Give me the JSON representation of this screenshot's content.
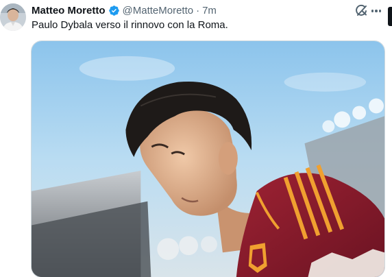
{
  "tweet": {
    "author": {
      "display_name": "Matteo Moretto",
      "handle": "@MatteMoretto",
      "verified": true
    },
    "separator": "·",
    "time": "7m",
    "text": "Paulo Dybala verso il rinnovo con la Roma.",
    "media": {
      "type": "photo",
      "subject": "footballer",
      "colors": {
        "sky": "#8cc4ec",
        "jersey": "#8a1c2c",
        "stripes": "#f0a030",
        "hair": "#1e1a18"
      }
    }
  },
  "icons": {
    "verified": "verified-badge-icon",
    "grok": "grok-icon",
    "more": "more-options-icon"
  },
  "colors": {
    "verified_blue": "#1d9bf0",
    "secondary_text": "#536471"
  }
}
